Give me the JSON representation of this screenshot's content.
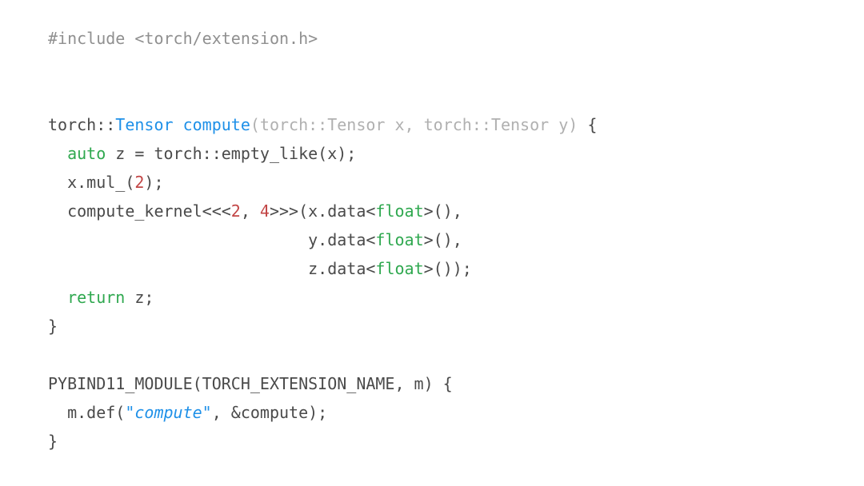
{
  "code": {
    "lines": [
      {
        "segments": [
          {
            "cls": "tok-macro",
            "text": "#include <torch/extension.h>"
          }
        ]
      },
      {
        "segments": [
          {
            "cls": "tok-plain",
            "text": ""
          }
        ]
      },
      {
        "segments": [
          {
            "cls": "tok-plain",
            "text": ""
          }
        ]
      },
      {
        "segments": [
          {
            "cls": "tok-plain",
            "text": "torch::"
          },
          {
            "cls": "tok-type1",
            "text": "Tensor"
          },
          {
            "cls": "tok-plain",
            "text": " "
          },
          {
            "cls": "tok-func",
            "text": "compute"
          },
          {
            "cls": "tok-param",
            "text": "(torch::Tensor x, torch::Tensor y)"
          },
          {
            "cls": "tok-plain",
            "text": " {"
          }
        ]
      },
      {
        "segments": [
          {
            "cls": "tok-plain",
            "text": "  "
          },
          {
            "cls": "tok-kw",
            "text": "auto"
          },
          {
            "cls": "tok-plain",
            "text": " z = torch::empty_like(x);"
          }
        ]
      },
      {
        "segments": [
          {
            "cls": "tok-plain",
            "text": "  x.mul_("
          },
          {
            "cls": "tok-num2",
            "text": "2"
          },
          {
            "cls": "tok-plain",
            "text": ");"
          }
        ]
      },
      {
        "segments": [
          {
            "cls": "tok-plain",
            "text": "  compute_kernel<<<"
          },
          {
            "cls": "tok-num2",
            "text": "2"
          },
          {
            "cls": "tok-plain",
            "text": ", "
          },
          {
            "cls": "tok-num2",
            "text": "4"
          },
          {
            "cls": "tok-plain",
            "text": ">>>(x.data<"
          },
          {
            "cls": "tok-kw",
            "text": "float"
          },
          {
            "cls": "tok-plain",
            "text": ">(),"
          }
        ]
      },
      {
        "segments": [
          {
            "cls": "tok-plain",
            "text": "                           y.data<"
          },
          {
            "cls": "tok-kw",
            "text": "float"
          },
          {
            "cls": "tok-plain",
            "text": ">(),"
          }
        ]
      },
      {
        "segments": [
          {
            "cls": "tok-plain",
            "text": "                           z.data<"
          },
          {
            "cls": "tok-kw",
            "text": "float"
          },
          {
            "cls": "tok-plain",
            "text": ">());"
          }
        ]
      },
      {
        "segments": [
          {
            "cls": "tok-plain",
            "text": "  "
          },
          {
            "cls": "tok-kw",
            "text": "return"
          },
          {
            "cls": "tok-plain",
            "text": " z;"
          }
        ]
      },
      {
        "segments": [
          {
            "cls": "tok-plain",
            "text": "}"
          }
        ]
      },
      {
        "segments": [
          {
            "cls": "tok-plain",
            "text": ""
          }
        ]
      },
      {
        "segments": [
          {
            "cls": "tok-plain",
            "text": "PYBIND11_MODULE(TORCH_EXTENSION_NAME, m) {"
          }
        ]
      },
      {
        "segments": [
          {
            "cls": "tok-plain",
            "text": "  m.def("
          },
          {
            "cls": "tok-str",
            "text": "\"compute\""
          },
          {
            "cls": "tok-plain",
            "text": ", &compute);"
          }
        ]
      },
      {
        "segments": [
          {
            "cls": "tok-plain",
            "text": "}"
          }
        ]
      }
    ]
  }
}
